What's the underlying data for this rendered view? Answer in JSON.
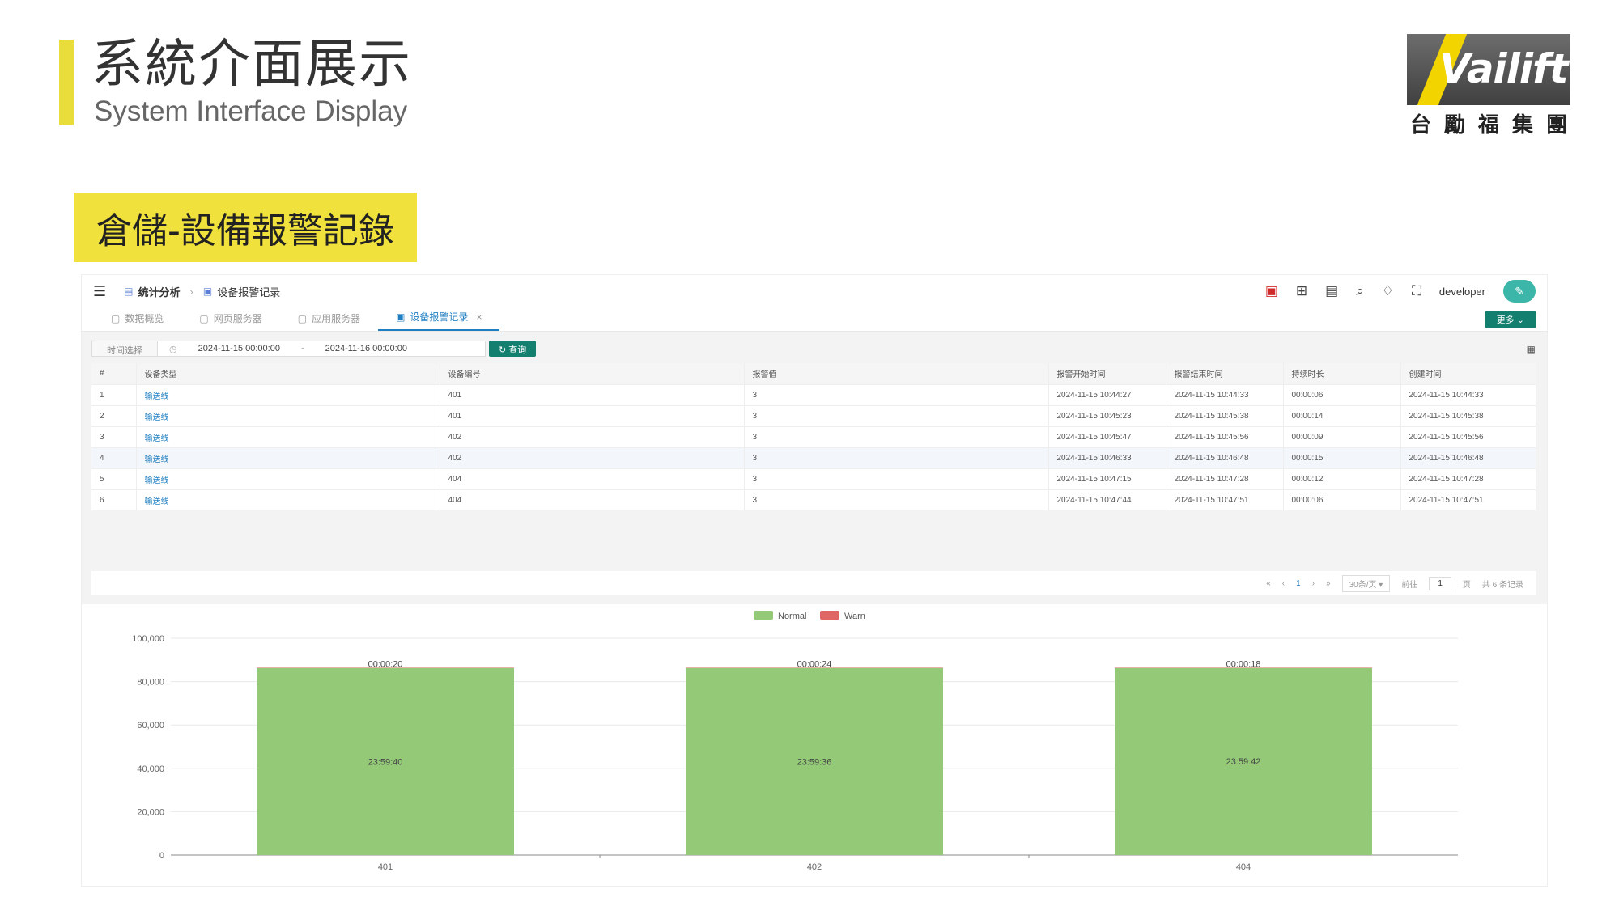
{
  "slide": {
    "title_zh": "系統介面展示",
    "title_en": "System Interface Display",
    "section_label": "倉儲-設備報警記錄",
    "logo": {
      "wordmark": "Vailift",
      "subtitle": [
        "台",
        "勵",
        "福",
        "集",
        "團"
      ]
    }
  },
  "app": {
    "breadcrumb": {
      "parent": "统计分析",
      "current": "设备报警记录"
    },
    "user": "developer",
    "tabs": [
      {
        "label": "数据概览",
        "active": false
      },
      {
        "label": "网页服务器",
        "active": false
      },
      {
        "label": "应用服务器",
        "active": false
      },
      {
        "label": "设备报警记录",
        "active": true
      }
    ],
    "more_button": "更多",
    "filter": {
      "label": "时间选择",
      "start": "2024-11-15 00:00:00",
      "separator": "-",
      "end": "2024-11-16 00:00:00",
      "query_button": "查询"
    },
    "table": {
      "columns": [
        "#",
        "设备类型",
        "设备编号",
        "报警值",
        "报警开始时间",
        "报警结束时间",
        "持续时长",
        "创建时间"
      ],
      "rows": [
        [
          "1",
          "输送线",
          "401",
          "3",
          "2024-11-15 10:44:27",
          "2024-11-15 10:44:33",
          "00:00:06",
          "2024-11-15 10:44:33"
        ],
        [
          "2",
          "输送线",
          "401",
          "3",
          "2024-11-15 10:45:23",
          "2024-11-15 10:45:38",
          "00:00:14",
          "2024-11-15 10:45:38"
        ],
        [
          "3",
          "输送线",
          "402",
          "3",
          "2024-11-15 10:45:47",
          "2024-11-15 10:45:56",
          "00:00:09",
          "2024-11-15 10:45:56"
        ],
        [
          "4",
          "输送线",
          "402",
          "3",
          "2024-11-15 10:46:33",
          "2024-11-15 10:46:48",
          "00:00:15",
          "2024-11-15 10:46:48"
        ],
        [
          "5",
          "输送线",
          "404",
          "3",
          "2024-11-15 10:47:15",
          "2024-11-15 10:47:28",
          "00:00:12",
          "2024-11-15 10:47:28"
        ],
        [
          "6",
          "输送线",
          "404",
          "3",
          "2024-11-15 10:47:44",
          "2024-11-15 10:47:51",
          "00:00:06",
          "2024-11-15 10:47:51"
        ]
      ]
    },
    "pager": {
      "first": "«",
      "prev": "‹",
      "page": "1",
      "next": "›",
      "last": "»",
      "page_size": "30条/页",
      "goto_label": "前往",
      "goto_value": "1",
      "page_unit": "页",
      "total": "共 6 条记录"
    }
  },
  "chart_data": {
    "type": "bar",
    "categories": [
      "401",
      "402",
      "404"
    ],
    "series": [
      {
        "name": "Normal",
        "color": "#93c977",
        "values": [
          86380,
          86376,
          86382
        ],
        "labels": [
          "23:59:40",
          "23:59:36",
          "23:59:42"
        ]
      },
      {
        "name": "Warn",
        "color": "#e06666",
        "values": [
          20,
          24,
          18
        ],
        "labels": [
          "00:00:20",
          "00:00:24",
          "00:00:18"
        ]
      }
    ],
    "stacked": true,
    "ylim": [
      0,
      100000
    ],
    "yticks": [
      "0",
      "20,000",
      "40,000",
      "60,000",
      "80,000",
      "100,000"
    ],
    "legend_position": "top-center",
    "grid": true
  }
}
